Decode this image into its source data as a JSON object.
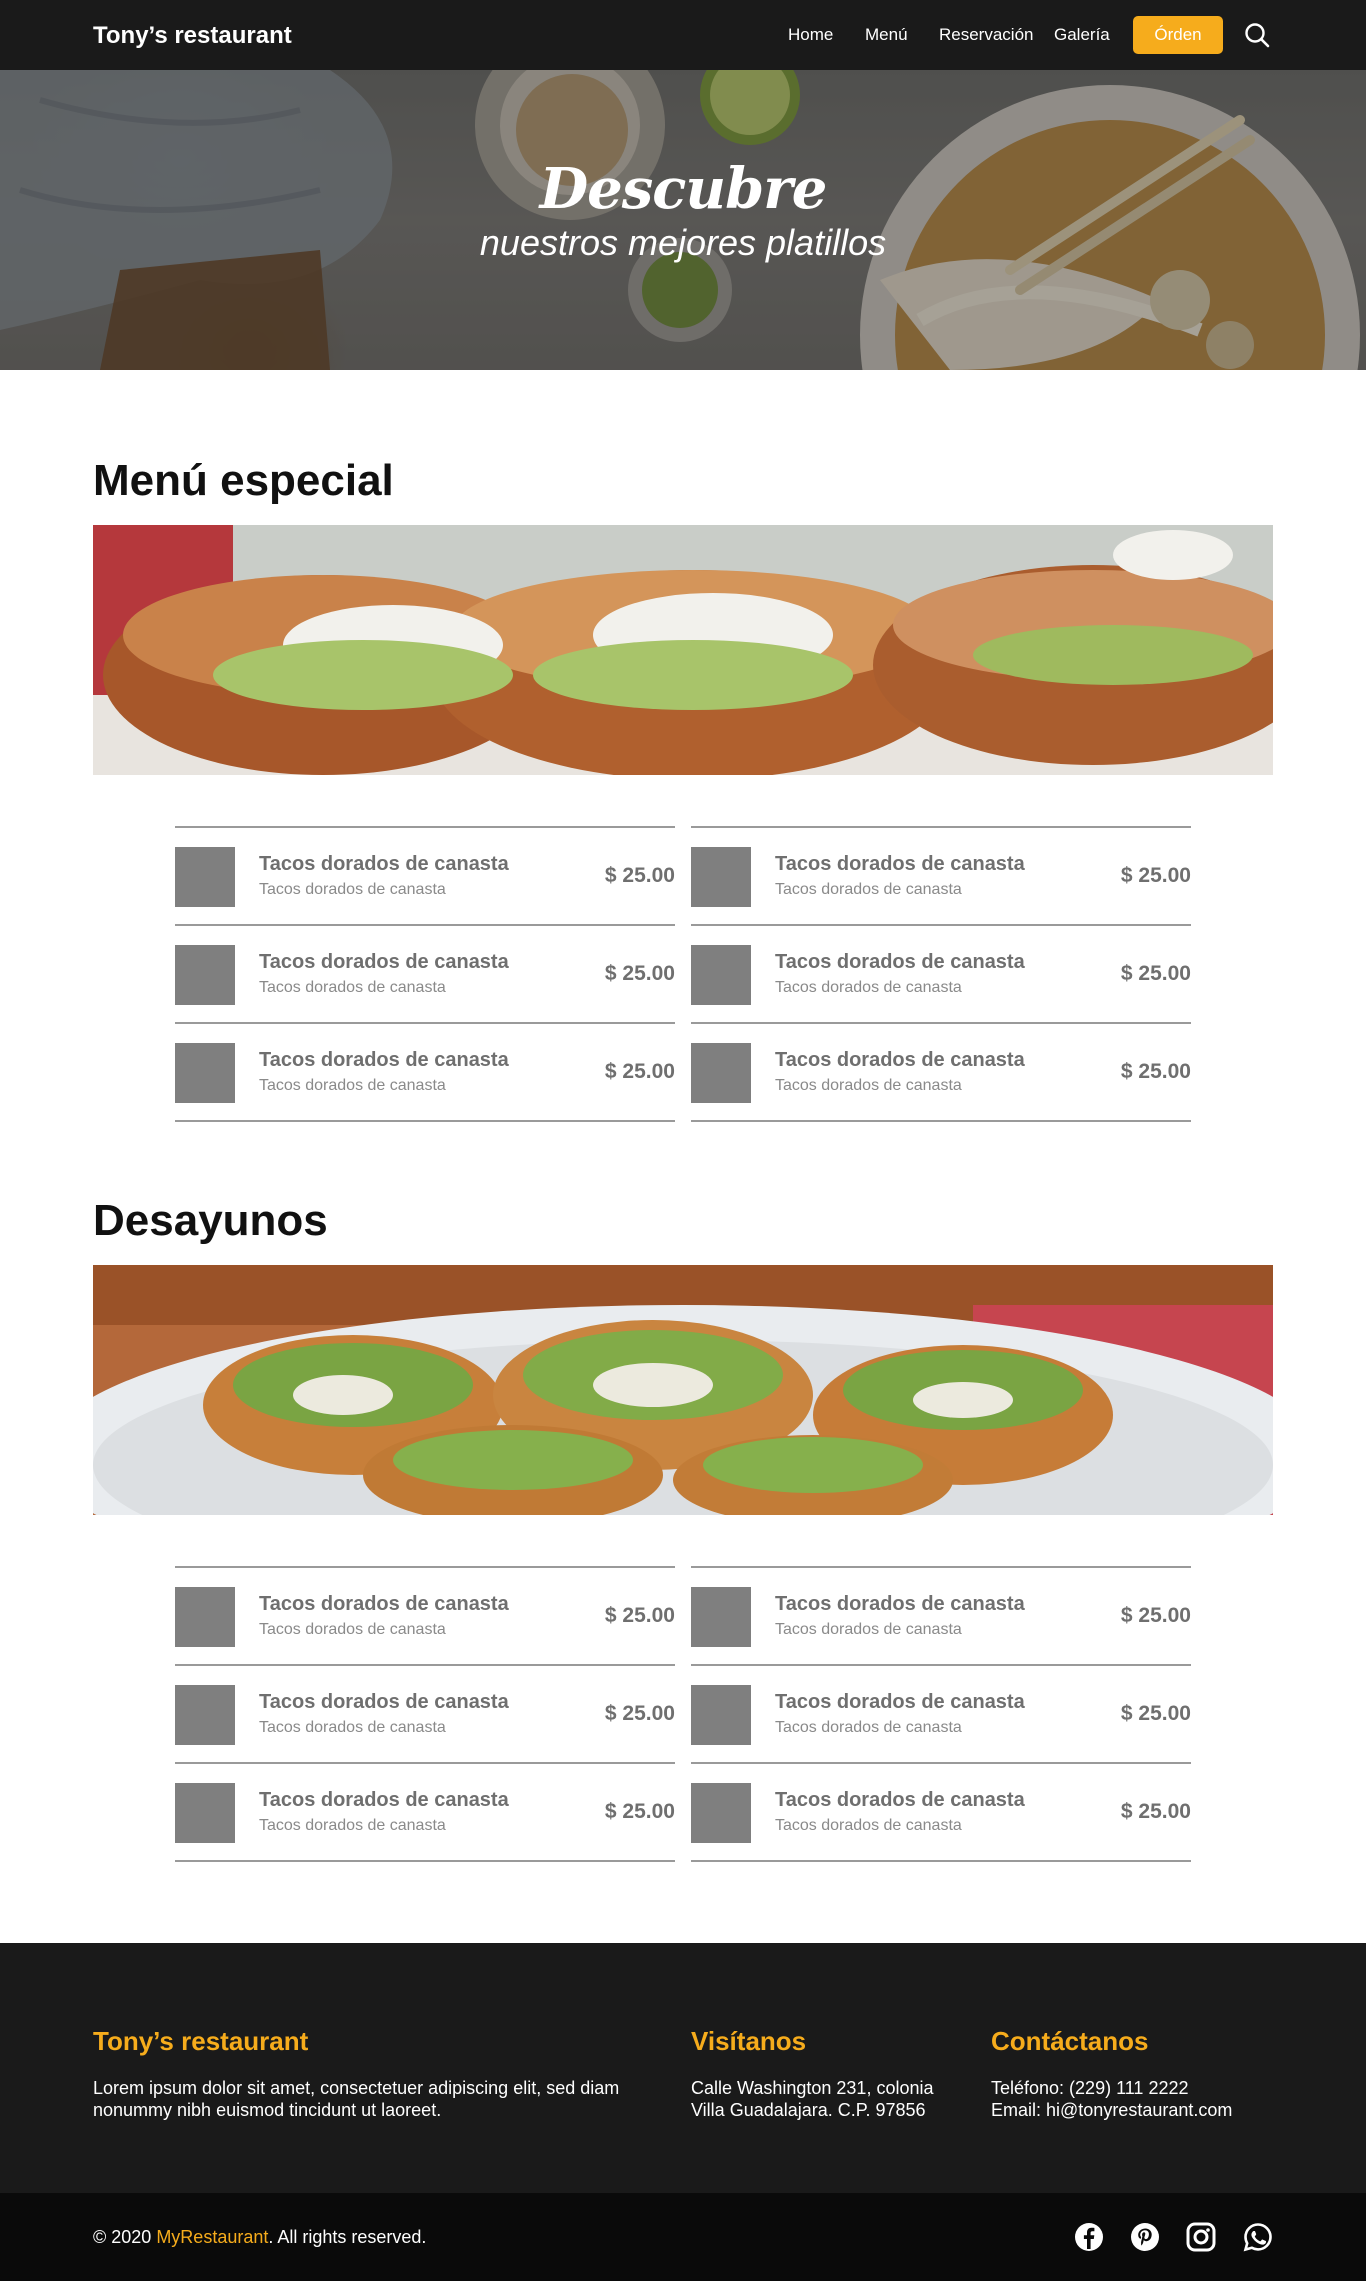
{
  "nav": {
    "brand": "Tony’s restaurant",
    "links": [
      "Home",
      "Menú",
      "Reservación",
      "Galería"
    ],
    "order_button": "Órden",
    "search_icon": "search-icon"
  },
  "hero": {
    "title": "Descubre",
    "subtitle": "nuestros mejores platillos"
  },
  "sections": [
    {
      "title": "Menú especial",
      "items": [
        {
          "name": "Tacos dorados de canasta",
          "desc": "Tacos dorados de canasta",
          "price": "$ 25.00"
        },
        {
          "name": "Tacos dorados de canasta",
          "desc": "Tacos dorados de canasta",
          "price": "$ 25.00"
        },
        {
          "name": "Tacos dorados de canasta",
          "desc": "Tacos dorados de canasta",
          "price": "$ 25.00"
        },
        {
          "name": "Tacos dorados de canasta",
          "desc": "Tacos dorados de canasta",
          "price": "$ 25.00"
        },
        {
          "name": "Tacos dorados de canasta",
          "desc": "Tacos dorados de canasta",
          "price": "$ 25.00"
        },
        {
          "name": "Tacos dorados de canasta",
          "desc": "Tacos dorados de canasta",
          "price": "$ 25.00"
        }
      ]
    },
    {
      "title": "Desayunos",
      "items": [
        {
          "name": "Tacos dorados de canasta",
          "desc": "Tacos dorados de canasta",
          "price": "$ 25.00"
        },
        {
          "name": "Tacos dorados de canasta",
          "desc": "Tacos dorados de canasta",
          "price": "$ 25.00"
        },
        {
          "name": "Tacos dorados de canasta",
          "desc": "Tacos dorados de canasta",
          "price": "$ 25.00"
        },
        {
          "name": "Tacos dorados de canasta",
          "desc": "Tacos dorados de canasta",
          "price": "$ 25.00"
        },
        {
          "name": "Tacos dorados de canasta",
          "desc": "Tacos dorados de canasta",
          "price": "$ 25.00"
        },
        {
          "name": "Tacos dorados de canasta",
          "desc": "Tacos dorados de canasta",
          "price": "$ 25.00"
        }
      ]
    }
  ],
  "footer": {
    "about_title": "Tony’s restaurant",
    "about_text": "Lorem ipsum dolor sit amet, consectetuer adipiscing elit, sed diam nonummy nibh euismod tincidunt ut laoreet.",
    "visit_title": "Visítanos",
    "visit_line1": "Calle Washington 231, colonia",
    "visit_line2": "Villa Guadalajara. C.P. 97856",
    "contact_title": "Contáctanos",
    "contact_phone": "Teléfono: (229) 111 2222",
    "contact_email": "Email: hi@tonyrestaurant.com"
  },
  "bottom": {
    "copy_prefix": "© 2020 ",
    "copy_brand": "MyRestaurant",
    "copy_suffix": ". All rights reserved.",
    "social_icons": [
      "facebook-icon",
      "pinterest-icon",
      "instagram-icon",
      "whatsapp-icon"
    ]
  },
  "colors": {
    "accent": "#f6ac1c",
    "nav_bg": "#1a1a1a",
    "footer_bg": "#1a1a1a",
    "bottom_bg": "#0a0a0a",
    "thumb": "#7f7f7f"
  }
}
